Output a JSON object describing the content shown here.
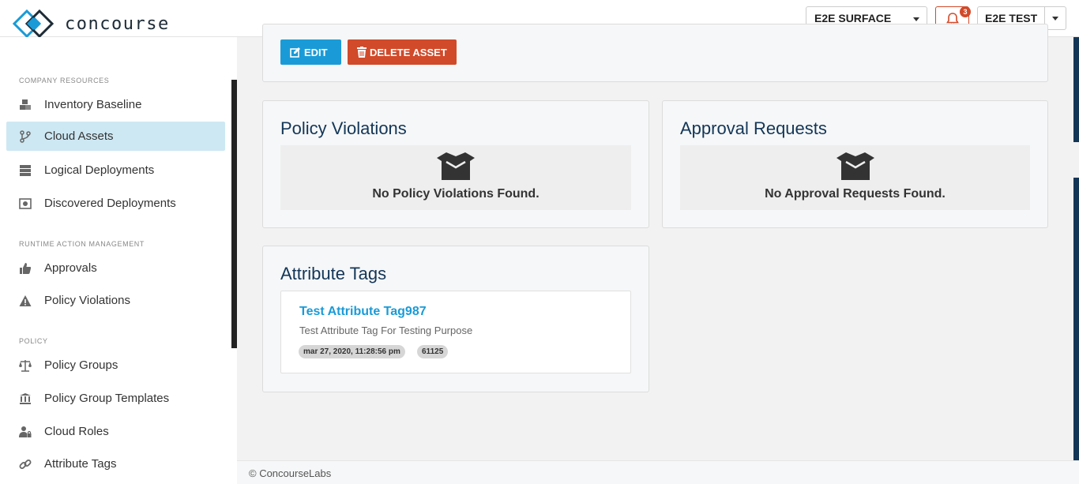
{
  "header": {
    "brand": "concourse",
    "org_select": "E2E SURFACE",
    "notification_count": "3",
    "user_select": "E2E TEST"
  },
  "sidebar": {
    "sections": [
      {
        "title": "COMPANY RESOURCES",
        "items": [
          "Inventory Baseline",
          "Cloud Assets",
          "Logical Deployments",
          "Discovered Deployments"
        ]
      },
      {
        "title": "RUNTIME ACTION MANAGEMENT",
        "items": [
          "Approvals",
          "Policy Violations"
        ]
      },
      {
        "title": "POLICY",
        "items": [
          "Policy Groups",
          "Policy Group Templates",
          "Cloud Roles",
          "Attribute Tags"
        ]
      }
    ],
    "active_item": "Cloud Assets"
  },
  "actions": {
    "edit_label": "EDIT",
    "delete_label": "DELETE ASSET"
  },
  "policy_violations": {
    "title": "Policy Violations",
    "empty_text": "No Policy Violations Found."
  },
  "approval_requests": {
    "title": "Approval Requests",
    "empty_text": "No Approval Requests Found."
  },
  "attribute_tags": {
    "title": "Attribute Tags",
    "items": [
      {
        "name": "Test Attribute Tag987",
        "description": "Test Attribute Tag For Testing Purpose",
        "timestamp": "mar 27, 2020, 11:28:56 pm",
        "id": "61125"
      }
    ]
  },
  "footer": {
    "text": "© ConcourseLabs"
  },
  "colors": {
    "primary": "#1a9bd7",
    "danger": "#d14a2a",
    "title": "#133657",
    "active_nav": "#cde8f3"
  }
}
